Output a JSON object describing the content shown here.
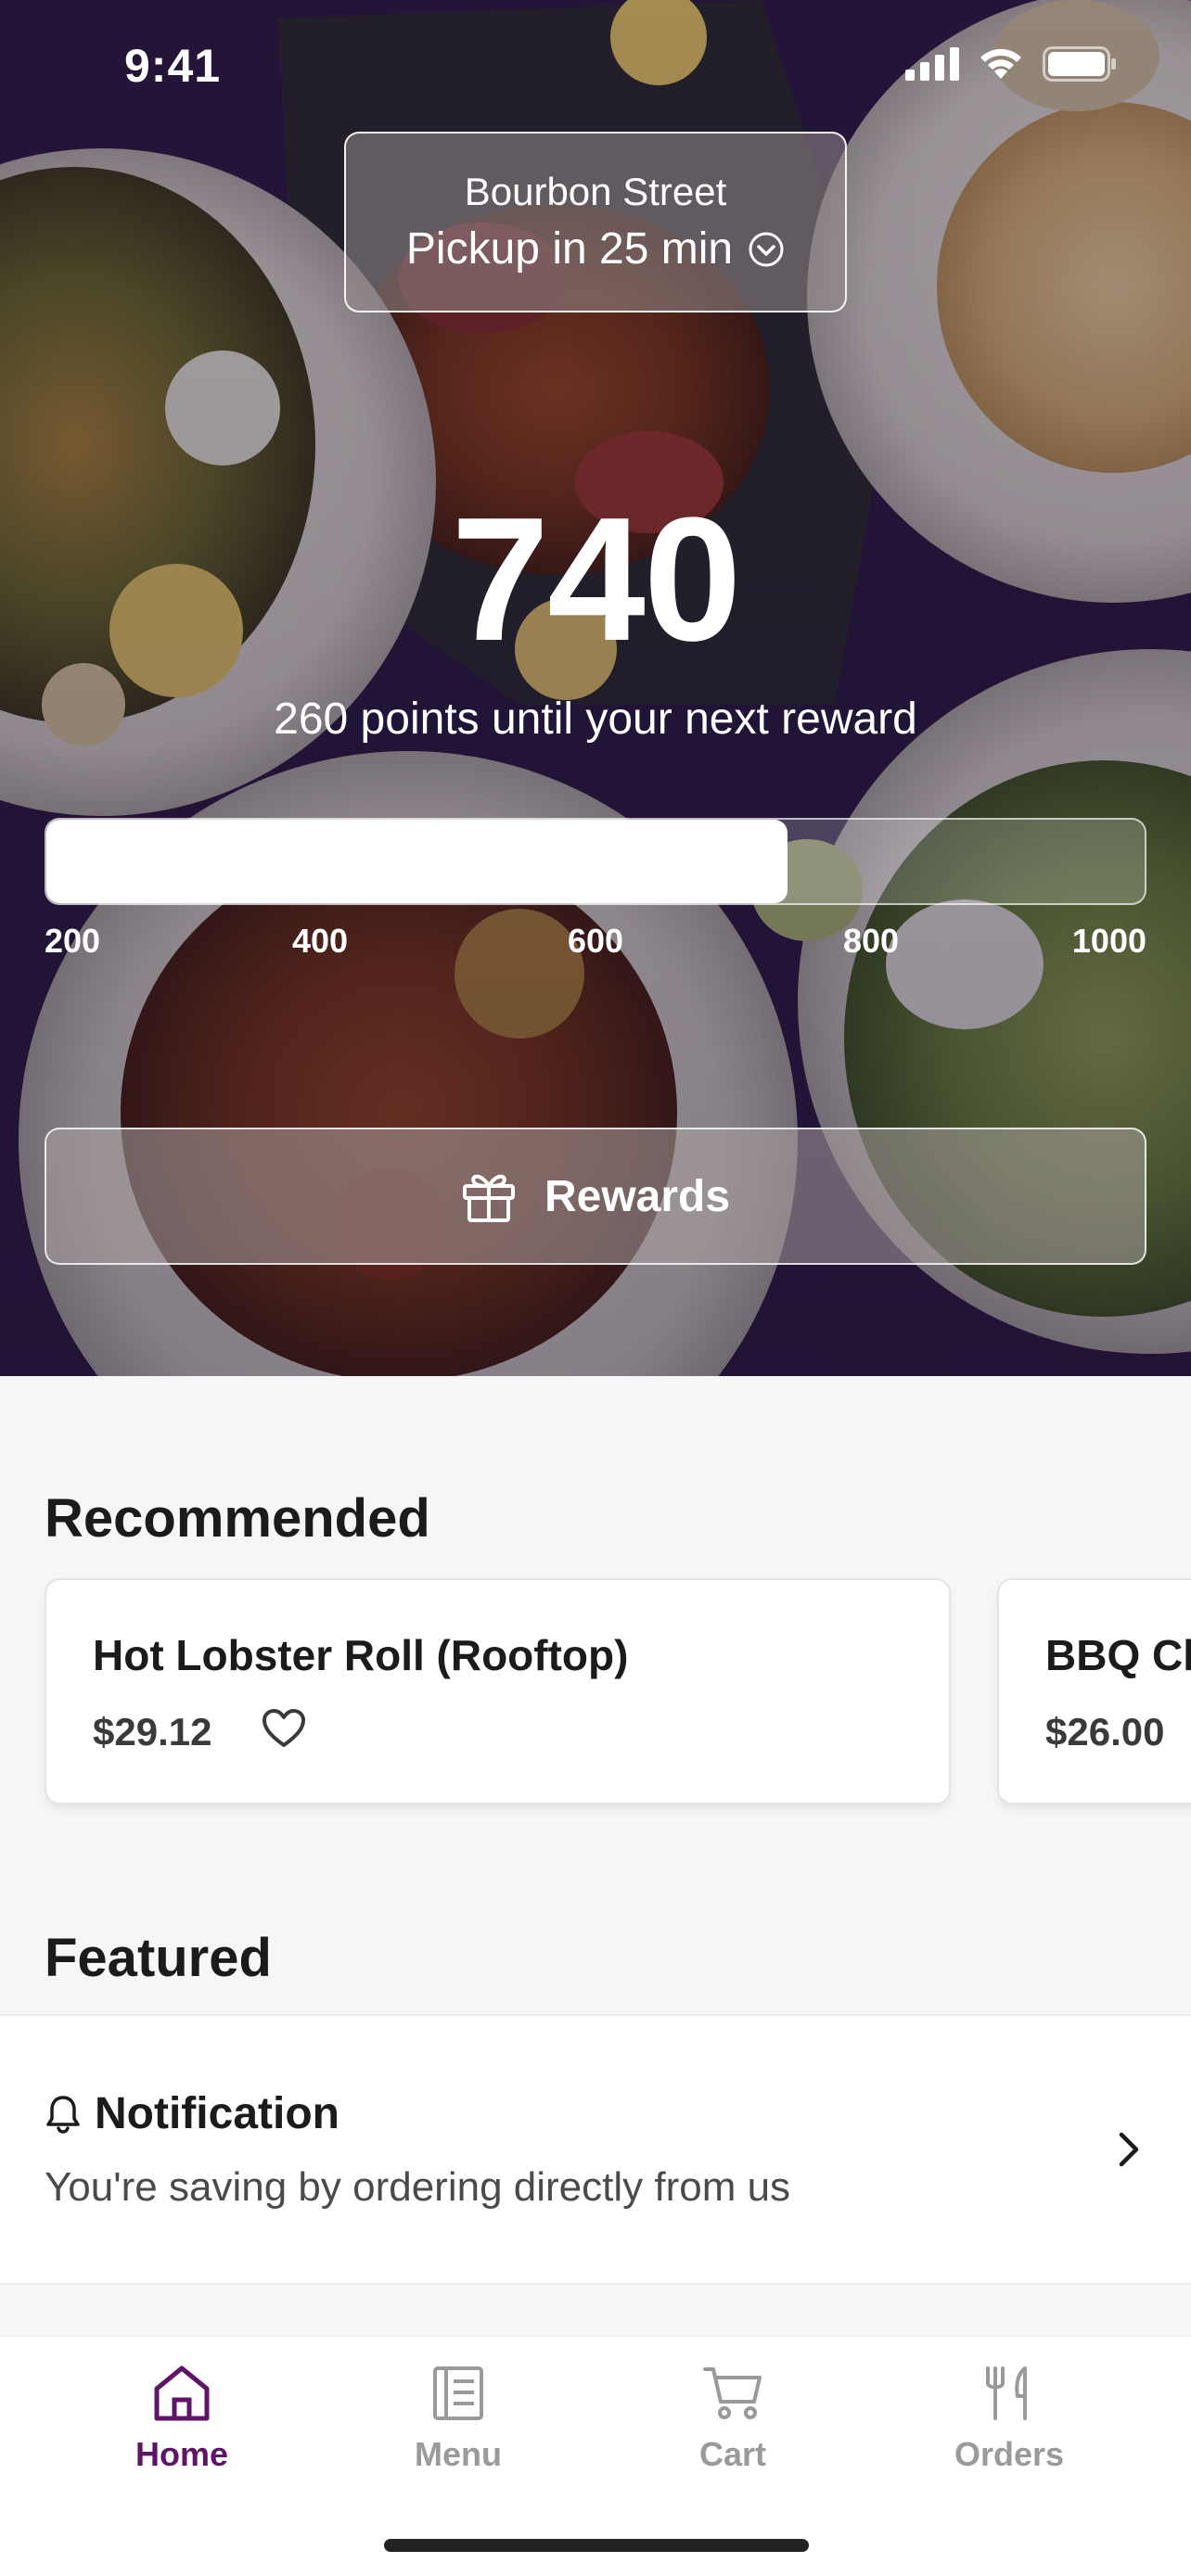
{
  "status_bar": {
    "time": "9:41"
  },
  "location": {
    "name": "Bourbon Street",
    "pickup": "Pickup in 25 min"
  },
  "rewards": {
    "points": "740",
    "subtitle": "260 points until your next reward",
    "progress_value": 740,
    "scale_min": 200,
    "scale_max": 1000,
    "ticks": [
      "200",
      "400",
      "600",
      "800",
      "1000"
    ],
    "button_label": "Rewards"
  },
  "recommended": {
    "title": "Recommended",
    "items": [
      {
        "name": "Hot Lobster Roll (Rooftop)",
        "price": "$29.12"
      },
      {
        "name": "BBQ Ch",
        "price": "$26.00"
      }
    ]
  },
  "featured": {
    "title": "Featured",
    "notification": {
      "title": "Notification",
      "body": "You're saving by ordering directly from us"
    }
  },
  "tabs": [
    {
      "label": "Home",
      "icon": "home-icon",
      "active": true
    },
    {
      "label": "Menu",
      "icon": "menu-icon",
      "active": false
    },
    {
      "label": "Cart",
      "icon": "cart-icon",
      "active": false
    },
    {
      "label": "Orders",
      "icon": "orders-icon",
      "active": false
    }
  ],
  "colors": {
    "accent": "#5e1566",
    "hero_bg": "#2a1a40",
    "inactive_tab": "#9a9a9a"
  }
}
